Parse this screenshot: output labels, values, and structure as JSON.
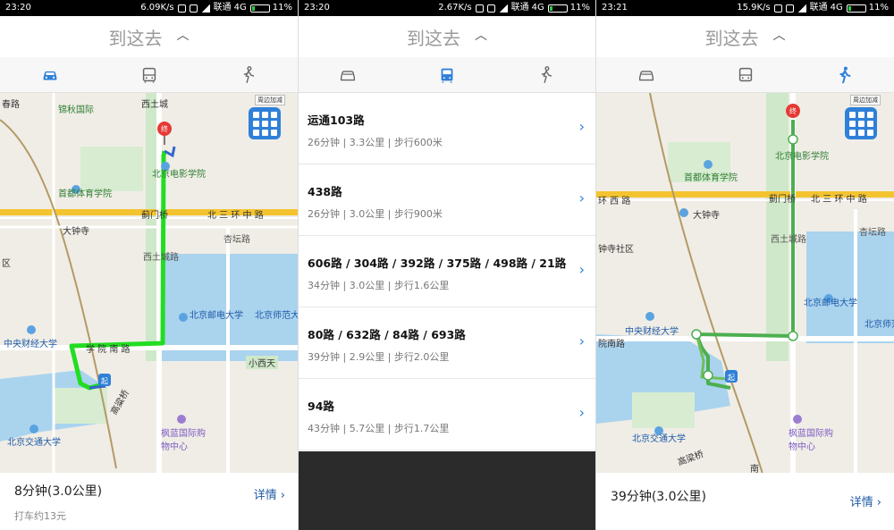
{
  "colors": {
    "accent": "#2f80d8",
    "route_green": "#22dd22",
    "walk_green": "#4caf50",
    "ring_road": "#f4c430"
  },
  "title": {
    "label": "到这去",
    "toggle_icon": "chevron-up-icon"
  },
  "modes": [
    {
      "name": "car",
      "icon": "car-icon"
    },
    {
      "name": "bus",
      "icon": "bus-icon"
    },
    {
      "name": "walk",
      "icon": "walk-icon"
    }
  ],
  "panels": [
    {
      "status": {
        "time": "23:20",
        "speed": "6.09K/s",
        "carrier": "联通",
        "network": "4G",
        "battery": "11%"
      },
      "active_mode": "car",
      "summary": {
        "duration": "8分钟(3.0公里)",
        "taxi": "打车约13元",
        "detail": "详情"
      }
    },
    {
      "status": {
        "time": "23:20",
        "speed": "2.67K/s",
        "carrier": "联通",
        "network": "4G",
        "battery": "11%"
      },
      "active_mode": "bus",
      "routes": [
        {
          "name": "运通103路",
          "info": "26分钟 | 3.3公里 | 步行600米"
        },
        {
          "name": "438路",
          "info": "26分钟 | 3.0公里 | 步行900米"
        },
        {
          "name": "606路 / 304路 / 392路 / 375路 / 498路 / 21路",
          "info": "34分钟 | 3.0公里 | 步行1.6公里"
        },
        {
          "name": "80路 / 632路 / 84路 / 693路",
          "info": "39分钟 | 2.9公里 | 步行2.0公里"
        },
        {
          "name": "94路",
          "info": "43分钟 | 5.7公里 | 步行1.7公里"
        }
      ]
    },
    {
      "status": {
        "time": "23:21",
        "speed": "15.9K/s",
        "carrier": "联通",
        "network": "4G",
        "battery": "11%"
      },
      "active_mode": "walk",
      "summary": {
        "duration": "39分钟(3.0公里)",
        "detail": "详情"
      }
    }
  ],
  "map1": {
    "labels": {
      "chunlu": "春路",
      "jinqiu": "锦秋国际",
      "xitucheng": "西土城",
      "film_academy": "北京电影学院",
      "sports_school": "首都体育学院",
      "jimenqiao": "蓟门桥",
      "north3ring": "北 三 环 中 路",
      "dazhongsi": "大钟寺",
      "xingtan": "杏坛路",
      "xitucheng_road": "西土城路",
      "bupt": "北京邮电大学",
      "bnu": "北京师范大",
      "cufe": "中央财经大学",
      "xueyuan_nan": "学 院 南 路",
      "xiaoxitian": "小西天",
      "area_qu": "区",
      "bjtu": "北京交通大学",
      "fenglan": "枫蓝国际购物中心",
      "haohuang": "高粱桥",
      "badge": "周边加减"
    }
  },
  "map3": {
    "labels": {
      "film_academy": "北京电影学院",
      "sports_school": "首都体育学院",
      "jimenqiao": "蓟门桥",
      "north3ring": "北 三 环 中 路",
      "xisanhuan": "环 西 路",
      "dazhongsi": "大钟寺",
      "community": "钟寺社区",
      "xingtan": "杏坛路",
      "xitucheng_road": "西土城路",
      "bupt": "北京邮电大学",
      "bnu": "北京师范大",
      "cufe": "中央财经大学",
      "yuan_nan": "院南路",
      "bjtu": "北京交通大学",
      "fenglan": "枫蓝国际购物中心",
      "gaoliang": "高梁桥",
      "nan": "南",
      "badge": "周边加减"
    }
  }
}
